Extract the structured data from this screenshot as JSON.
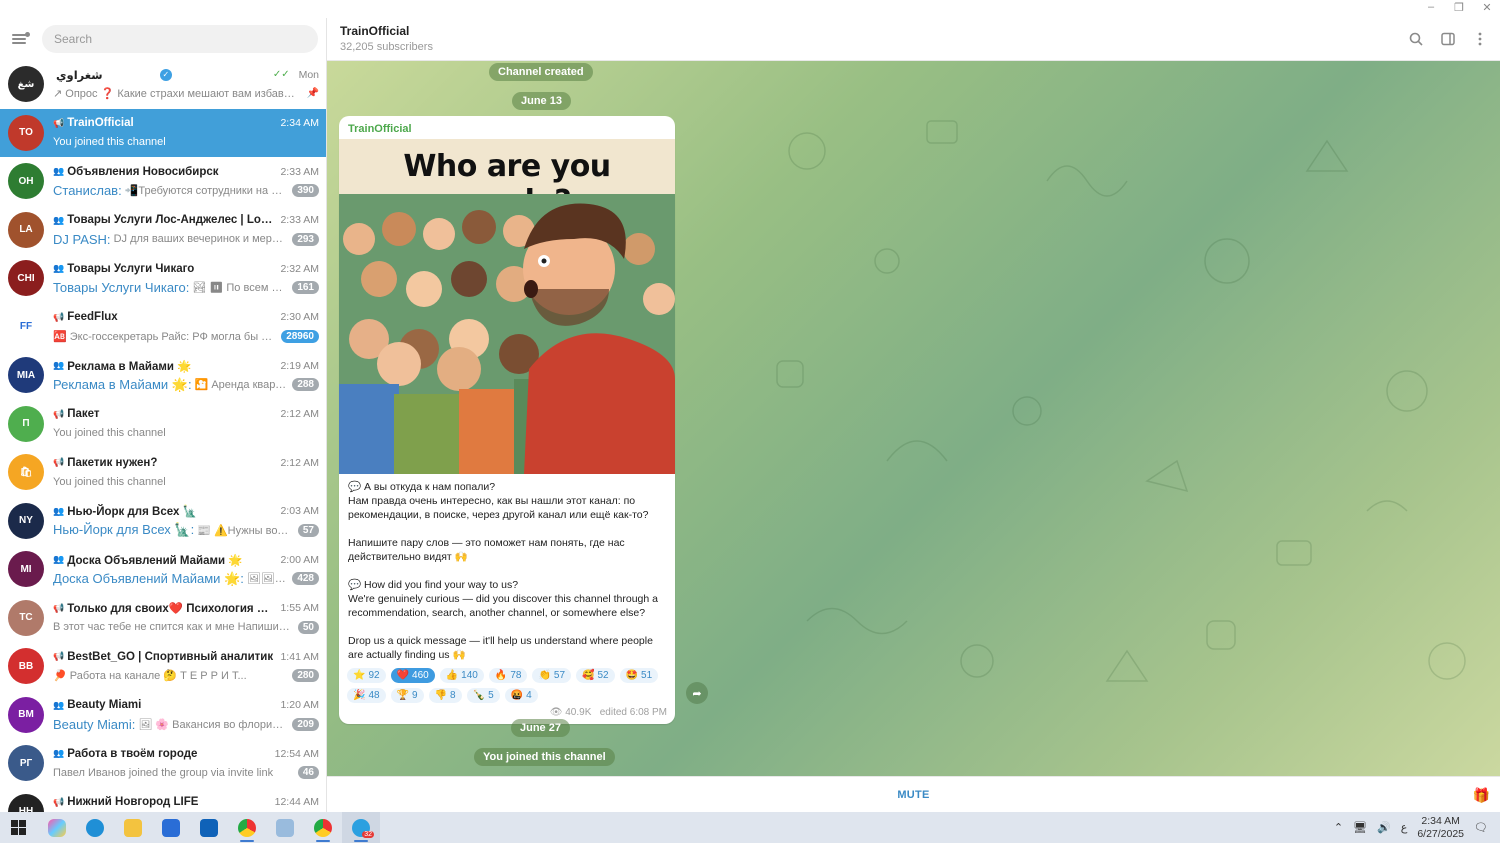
{
  "window": {
    "minimize": "–",
    "maximize": "❐",
    "close": "✕"
  },
  "search": {
    "placeholder": "Search"
  },
  "chats": [
    {
      "title": "شغراوي",
      "time": "Mon",
      "preview_sender": "",
      "preview": "↗ Опрос ❓ Какие страхи мешают вам избавит...",
      "badge": "",
      "type": "",
      "avatar_color": "#2b2b2b",
      "avatar_text": "شغ"
    },
    {
      "title": "TrainOfficial",
      "time": "2:34 AM",
      "preview_sender": "",
      "preview": "You joined this channel",
      "badge": "",
      "type": "📢",
      "avatar_color": "#c0392b",
      "avatar_text": "TO"
    },
    {
      "title": "Объявления Новосибирск",
      "time": "2:33 AM",
      "preview_sender": "Станислав:",
      "preview": "📲Требуются сотрудники на произв...",
      "badge": "390",
      "type": "👥",
      "avatar_color": "#2e7d32",
      "avatar_text": "ОН"
    },
    {
      "title": "Товары Услуги Лос-Анджелес | Los Ang...",
      "time": "2:33 AM",
      "preview_sender": "DJ PASH:",
      "preview": "DJ для ваших вечеринок и мероприят...",
      "badge": "293",
      "type": "👥",
      "avatar_color": "#a0522d",
      "avatar_text": "LA"
    },
    {
      "title": "Товары Услуги Чикаго",
      "time": "2:32 AM",
      "preview_sender": "Товары Услуги Чикаго:",
      "preview": "🏞 ⏸ По всем вопроса...",
      "badge": "161",
      "type": "👥",
      "avatar_color": "#8b1e1e",
      "avatar_text": "CHI"
    },
    {
      "title": "FeedFlux",
      "time": "2:30 AM",
      "preview_sender": "",
      "preview": "🆎 Экс-госсекретарь Райс: РФ могла бы убед...",
      "badge": "28960",
      "type": "📢",
      "avatar_color": "#ffffff",
      "avatar_text": "FF"
    },
    {
      "title": "Реклама в Майами 🌟",
      "time": "2:19 AM",
      "preview_sender": "Реклама в Майами 🌟:",
      "preview": "🎦 Аренда квартир Ма...",
      "badge": "288",
      "type": "👥",
      "avatar_color": "#1f3a7a",
      "avatar_text": "MIA"
    },
    {
      "title": "Пакет",
      "time": "2:12 AM",
      "preview_sender": "",
      "preview": "You joined this channel",
      "badge": "",
      "type": "📢",
      "avatar_color": "#4fae4e",
      "avatar_text": "П"
    },
    {
      "title": "Пакетик нужен?",
      "time": "2:12 AM",
      "preview_sender": "",
      "preview": "You joined this channel",
      "badge": "",
      "type": "📢",
      "avatar_color": "#f5a623",
      "avatar_text": "🛍"
    },
    {
      "title": "Нью-Йорк для Всех 🗽",
      "time": "2:03 AM",
      "preview_sender": "Нью-Йорк для Всех 🗽:",
      "preview": "📰 ⚠️Нужны водители ...",
      "badge": "57",
      "type": "👥",
      "avatar_color": "#1b2a4a",
      "avatar_text": "NY"
    },
    {
      "title": "Доска Объявлений Майами 🌟",
      "time": "2:00 AM",
      "preview_sender": "Доска Объявлений Майами 🌟:",
      "preview": "🖼🖼🖼 🌸Д...",
      "badge": "428",
      "type": "👥",
      "avatar_color": "#6a1b4d",
      "avatar_text": "MI"
    },
    {
      "title": "Только для своих❤️ Психология ❤️ Са...",
      "time": "1:55 AM",
      "preview_sender": "",
      "preview": "В этот час тебе не спится как и мне Напиши в ко...",
      "badge": "50",
      "type": "📢",
      "avatar_color": "#b07a6a",
      "avatar_text": "ТС"
    },
    {
      "title": "BestBet_GO | Спортивный аналитик",
      "time": "1:41 AM",
      "preview_sender": "",
      "preview": "🏓 Работа на канале 🤔 Т Е Р Р И Т...",
      "badge": "280",
      "type": "📢",
      "avatar_color": "#d32f2f",
      "avatar_text": "BB"
    },
    {
      "title": "Beauty Miami",
      "time": "1:20 AM",
      "preview_sender": "Beauty Miami:",
      "preview": "🖼 🌸 Вакансия во флористичес...",
      "badge": "209",
      "type": "👥",
      "avatar_color": "#7b1fa2",
      "avatar_text": "BM"
    },
    {
      "title": "Работа в твоём городе",
      "time": "12:54 AM",
      "preview_sender": "",
      "preview": "Павел Иванов joined the group via invite link",
      "badge": "46",
      "type": "👥",
      "avatar_color": "#3a5a8a",
      "avatar_text": "РГ"
    },
    {
      "title": "Нижний Новгород LIFE",
      "time": "12:44 AM",
      "preview_sender": "",
      "preview": "",
      "badge": "",
      "type": "📢",
      "avatar_color": "#222222",
      "avatar_text": "НН"
    }
  ],
  "header": {
    "title": "TrainOfficial",
    "subtitle": "32,205 subscribers"
  },
  "service": {
    "created": "Channel created",
    "date1": "June 13",
    "date2": "June 27",
    "joined": "You joined this channel"
  },
  "message": {
    "author": "TrainOfficial",
    "image_caption": "Who are you people?",
    "text": "💬 А вы откуда к нам попали?\nНам правда очень интересно, как вы нашли этот канал: по рекомендации, в поиске, через другой канал или ещё как-то?\n\nНапишите пару слов — это поможет нам понять, где нас действительно видят 🙌\n\n💬 How did you find your way to us?\nWe're genuinely curious — did you discover this channel through a recommendation, search, another channel, or somewhere else?\n\nDrop us a quick message — it'll help us understand where people are actually finding us 🙌",
    "reactions": [
      {
        "emoji": "⭐",
        "count": "92",
        "mine": false
      },
      {
        "emoji": "❤️",
        "count": "460",
        "mine": true
      },
      {
        "emoji": "👍",
        "count": "140",
        "mine": false
      },
      {
        "emoji": "🔥",
        "count": "78",
        "mine": false
      },
      {
        "emoji": "👏",
        "count": "57",
        "mine": false
      },
      {
        "emoji": "🥰",
        "count": "52",
        "mine": false
      },
      {
        "emoji": "🤩",
        "count": "51",
        "mine": false
      },
      {
        "emoji": "🎉",
        "count": "48",
        "mine": false
      },
      {
        "emoji": "🏆",
        "count": "9",
        "mine": false
      },
      {
        "emoji": "👎",
        "count": "8",
        "mine": false
      },
      {
        "emoji": "🍾",
        "count": "5",
        "mine": false
      },
      {
        "emoji": "🤬",
        "count": "4",
        "mine": false
      }
    ],
    "views": "40.9K",
    "edited": "edited 6:08 PM"
  },
  "footer": {
    "mute": "MUTE"
  },
  "taskbar": {
    "time": "2:34 AM",
    "date": "6/27/2025",
    "lang": "ع",
    "telegram_badge": "32"
  }
}
